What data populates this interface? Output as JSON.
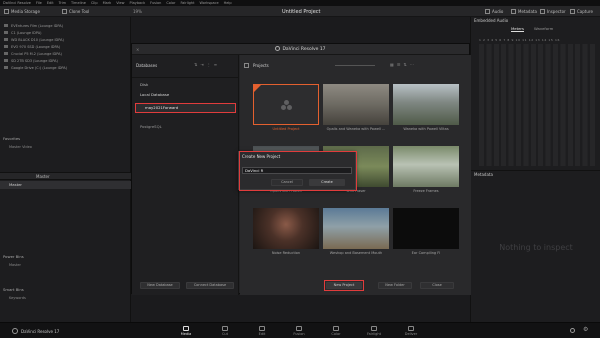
{
  "menubar": {
    "items": [
      "DaVinci Resolve",
      "File",
      "Edit",
      "Trim",
      "Timeline",
      "Clip",
      "Mark",
      "View",
      "Playback",
      "Fusion",
      "Color",
      "Fairlight",
      "Workspace",
      "Help"
    ]
  },
  "toolbar": {
    "media_storage": "Media Storage",
    "clone_tool": "Clone Tool",
    "title": "Untitled Project",
    "zoom": "19%",
    "audio": "Audio",
    "metadata": "Metadata",
    "inspector": "Inspector",
    "capture": "Capture"
  },
  "left_panel": {
    "volumes": [
      "EVEntures Film (Lounge IDPA)",
      "C1 (Lounge IDPA)",
      "WD BLACK D10 (Lounge IDPA)",
      "EVO 970 SSD (Lounge IDPA)",
      "Crucial P5 M.2 (Lounge IDPA)",
      "SD 2TB SD3 (Lounge IDPA)",
      "Google Drive (C:) (Lounge IDPA)"
    ],
    "favorites_label": "Favorites",
    "favorites_item": "Master Video",
    "master_header": "Master",
    "master_row": "Master",
    "power_bins_label": "Power Bins",
    "power_bins_item": "Master",
    "smart_bins_label": "Smart Bins",
    "smart_bins_item": "Keywords"
  },
  "right_panel": {
    "title": "Embedded Audio",
    "tab_meters": "Meters",
    "tab_waveform": "Waveform",
    "channels": "1 2 3 4 5 6 7 8 9 10 11 12 13 14 15 16",
    "metadata_label": "Metadata",
    "nothing": "Nothing to inspect"
  },
  "dialog": {
    "title": "DaVinci Resolve 17",
    "databases_label": "Databases",
    "disk_label": "Disk",
    "local_db": "Local Database",
    "selected_db": "may2021Forward",
    "postgres_label": "PostgreSQL",
    "new_database": "New Database",
    "connect_database": "Connect Database",
    "projects_label": "Projects",
    "projects": [
      {
        "name": "Untitled Project"
      },
      {
        "name": "Opalis and Waneka with Powell ..."
      },
      {
        "name": "Waneka with Powell Viltas"
      },
      {
        "name": "Opalis with Powell"
      },
      {
        "name": "Wild Fraser"
      },
      {
        "name": "Freeze Frames"
      },
      {
        "name": "Noise Reduction"
      },
      {
        "name": "Weshop and Basement Mouth"
      },
      {
        "name": "Ear Compiling FI"
      }
    ],
    "new_project_button": "New Project",
    "new_folder_button": "New Folder",
    "close_button": "Close",
    "create": {
      "title": "Create New Project",
      "value": "DaVinci R",
      "cancel": "Cancel",
      "create": "Create"
    }
  },
  "bottom": {
    "app_name": "DaVinci Resolve 17",
    "pages": [
      "Media",
      "Cut",
      "Edit",
      "Fusion",
      "Color",
      "Fairlight",
      "Deliver"
    ]
  },
  "colors": {
    "highlight": "#e03c3c",
    "accent": "#e3602f"
  }
}
